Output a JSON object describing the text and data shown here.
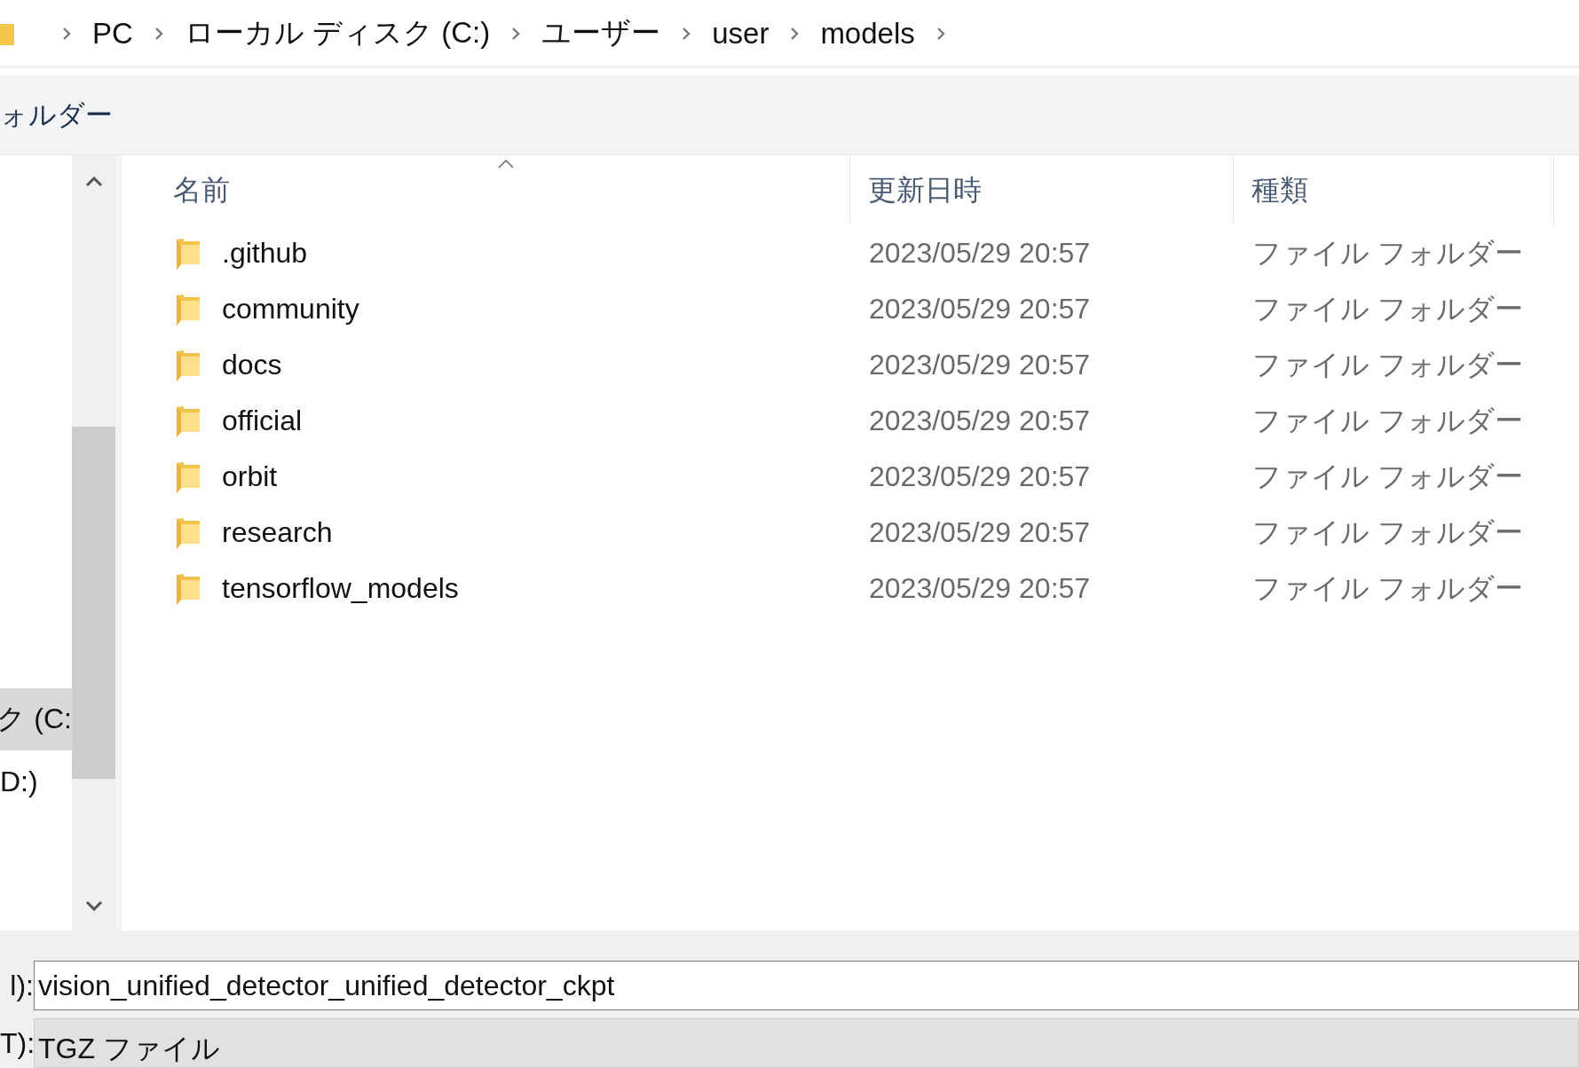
{
  "breadcrumb": [
    "PC",
    "ローカル ディスク (C:)",
    "ユーザー",
    "user",
    "models"
  ],
  "toolbar": {
    "label": "ォルダー"
  },
  "nav": [
    {
      "label": "ク (C:",
      "selected": true
    },
    {
      "label": "D:)",
      "selected": false
    }
  ],
  "table": {
    "columns": [
      "名前",
      "更新日時",
      "種類"
    ],
    "rows": [
      {
        "name": ".github",
        "modified": "2023/05/29 20:57",
        "type": "ファイル フォルダー"
      },
      {
        "name": "community",
        "modified": "2023/05/29 20:57",
        "type": "ファイル フォルダー"
      },
      {
        "name": "docs",
        "modified": "2023/05/29 20:57",
        "type": "ファイル フォルダー"
      },
      {
        "name": "official",
        "modified": "2023/05/29 20:57",
        "type": "ファイル フォルダー"
      },
      {
        "name": "orbit",
        "modified": "2023/05/29 20:57",
        "type": "ファイル フォルダー"
      },
      {
        "name": "research",
        "modified": "2023/05/29 20:57",
        "type": "ファイル フォルダー"
      },
      {
        "name": "tensorflow_models",
        "modified": "2023/05/29 20:57",
        "type": "ファイル フォルダー"
      }
    ]
  },
  "file_name": {
    "label": "l):",
    "value": "vision_unified_detector_unified_detector_ckpt"
  },
  "file_type": {
    "label": "T):",
    "value": "TGZ ファイル"
  }
}
